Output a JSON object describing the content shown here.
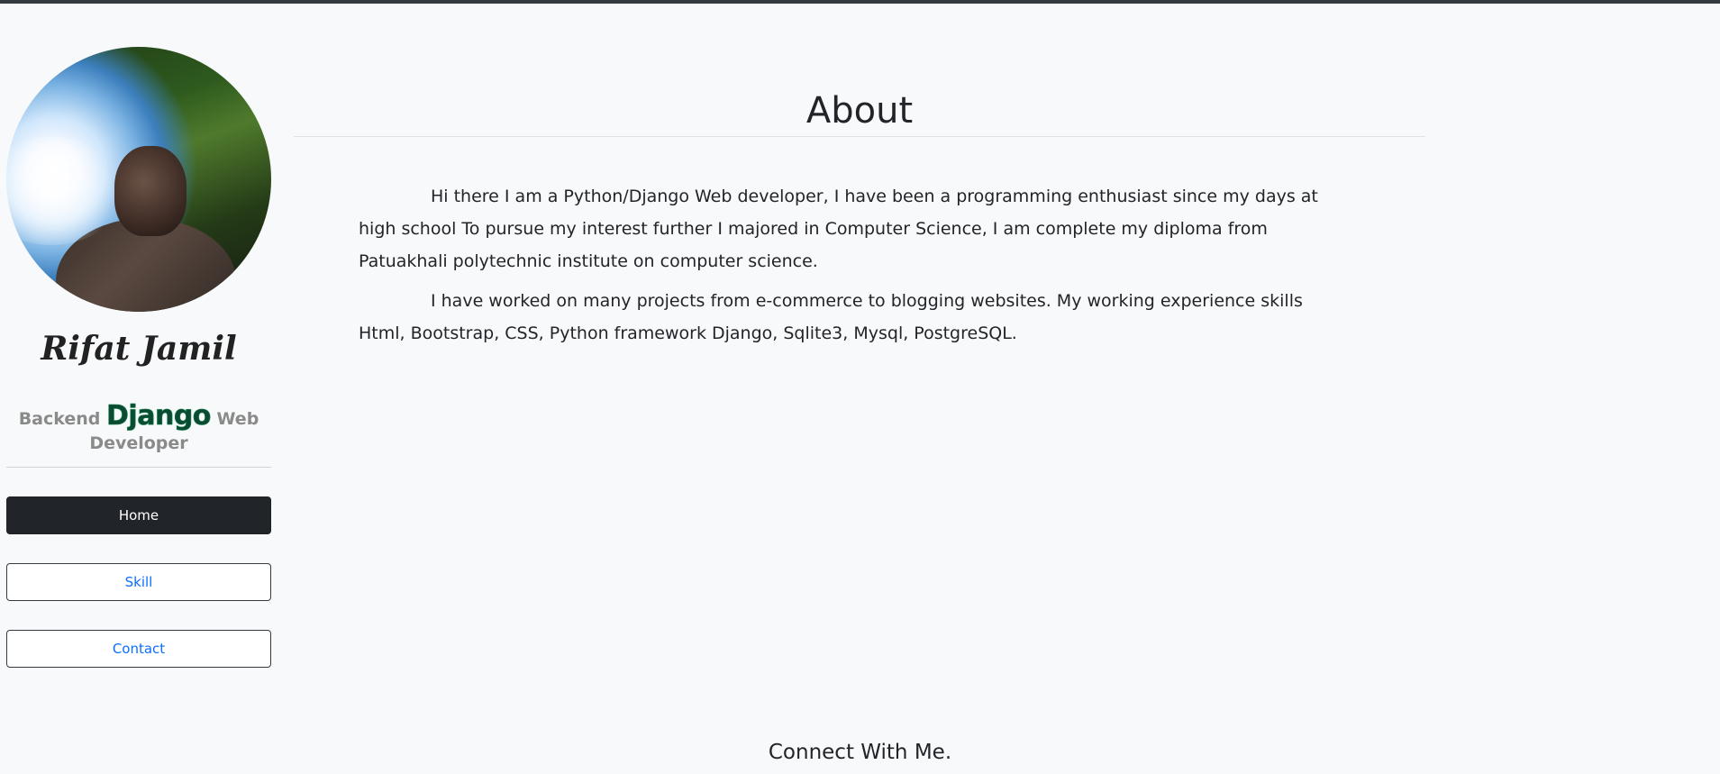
{
  "profile": {
    "name": "Rifat Jamil",
    "role_prefix": "Backend",
    "role_brand": "Django",
    "role_suffix": "Web Developer"
  },
  "nav": {
    "home": "Home",
    "skill": "Skill",
    "contact": "Contact"
  },
  "about": {
    "title": "About",
    "paragraphs": [
      "Hi there I am a Python/Django Web developer, I have been a programming enthusiast since my days at high school To pursue my interest further I majored in Computer Science, I am complete my diploma from Patuakhali polytechnic institute on computer science.",
      "I have worked on many projects from e-commerce to blogging websites. My working experience skills Html, Bootstrap, CSS, Python framework Django, Sqlite3, Mysql, PostgreSQL."
    ]
  },
  "footer": {
    "connect_heading": "Connect With Me."
  },
  "colors": {
    "topbar": "#343a40",
    "background": "#f8f9fa",
    "django_green": "#0c4b33",
    "link_blue": "#0d6efd",
    "dark_button": "#212529"
  },
  "icons": {
    "avatar": "profile-photo"
  }
}
